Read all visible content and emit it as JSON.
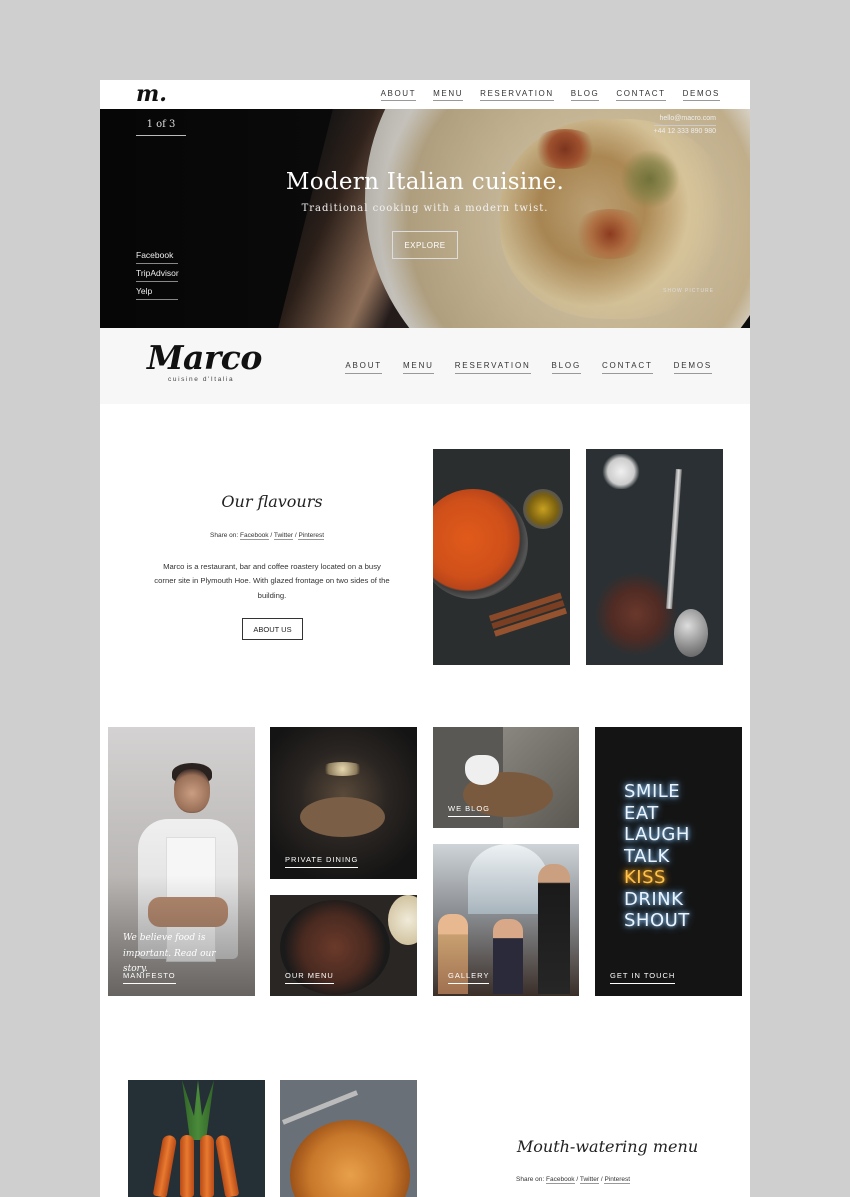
{
  "topbar": {
    "logo": "m.",
    "nav": [
      "ABOUT",
      "MENU",
      "RESERVATION",
      "BLOG",
      "CONTACT",
      "DEMOS"
    ]
  },
  "hero": {
    "counter": "1  of  3",
    "email": "hello@macro.com",
    "phone": "+44 12 333 890 980",
    "title": "Modern Italian cuisine.",
    "subtitle": "Traditional cooking with a modern twist.",
    "button": "EXPLORE",
    "social": [
      "Facebook",
      "TripAdvisor",
      "Yelp"
    ],
    "show_picture": "SHOW PICTURE"
  },
  "brand": {
    "logo": "Marco",
    "tagline": "cuisine d'Italia",
    "nav": [
      "ABOUT",
      "MENU",
      "RESERVATION",
      "BLOG",
      "CONTACT",
      "DEMOS"
    ]
  },
  "flavours": {
    "title": "Our flavours",
    "share_prefix": "Share on:",
    "share_links": [
      "Facebook",
      "Twitter",
      "Pinterest"
    ],
    "text": "Marco is a restaurant, bar and coffee roastery located on a busy corner site in Plymouth Hoe. With glazed frontage on two sides of the building.",
    "button": "ABOUT US"
  },
  "grid": {
    "manifesto_quote": "We believe food is important. Read our story.",
    "manifesto": "MANIFESTO",
    "private_dining": "PRIVATE DINING",
    "our_menu": "OUR MENU",
    "we_blog": "WE BLOG",
    "gallery": "GALLERY",
    "get_in_touch": "GET IN TOUCH",
    "neon_words": [
      "SMILE",
      "EAT",
      "LAUGH",
      "TALK",
      "KISS",
      "DRINK",
      "SHOUT"
    ]
  },
  "menu_section": {
    "title": "Mouth-watering menu",
    "share_prefix": "Share on:",
    "share_links": [
      "Facebook",
      "Twitter",
      "Pinterest"
    ]
  }
}
